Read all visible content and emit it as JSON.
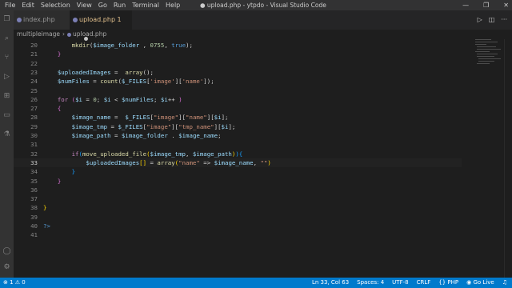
{
  "menu": [
    "File",
    "Edit",
    "Selection",
    "View",
    "Go",
    "Run",
    "Terminal",
    "Help"
  ],
  "window_title": "● upload.php - ytpdo - Visual Studio Code",
  "tabs": [
    {
      "label": "index.php",
      "active": false
    },
    {
      "label": "upload.php 1",
      "active": true
    }
  ],
  "breadcrumb": {
    "folder": "multipleimage",
    "file": "upload.php"
  },
  "lines": [
    20,
    21,
    22,
    23,
    24,
    25,
    26,
    27,
    28,
    29,
    30,
    31,
    32,
    33,
    34,
    35,
    36,
    37,
    38,
    39,
    40,
    41
  ],
  "status": {
    "problems": "⊗ 1 ⚠ 0",
    "position": "Ln 33, Col 63",
    "spaces": "Spaces: 4",
    "encoding": "UTF-8",
    "eol": "CRLF",
    "language": "PHP",
    "golive": "Go Live"
  },
  "colors": {
    "statusbar": "#007acc",
    "editor_bg": "#1e1e1e",
    "accent_tab": "#e2c08d"
  }
}
